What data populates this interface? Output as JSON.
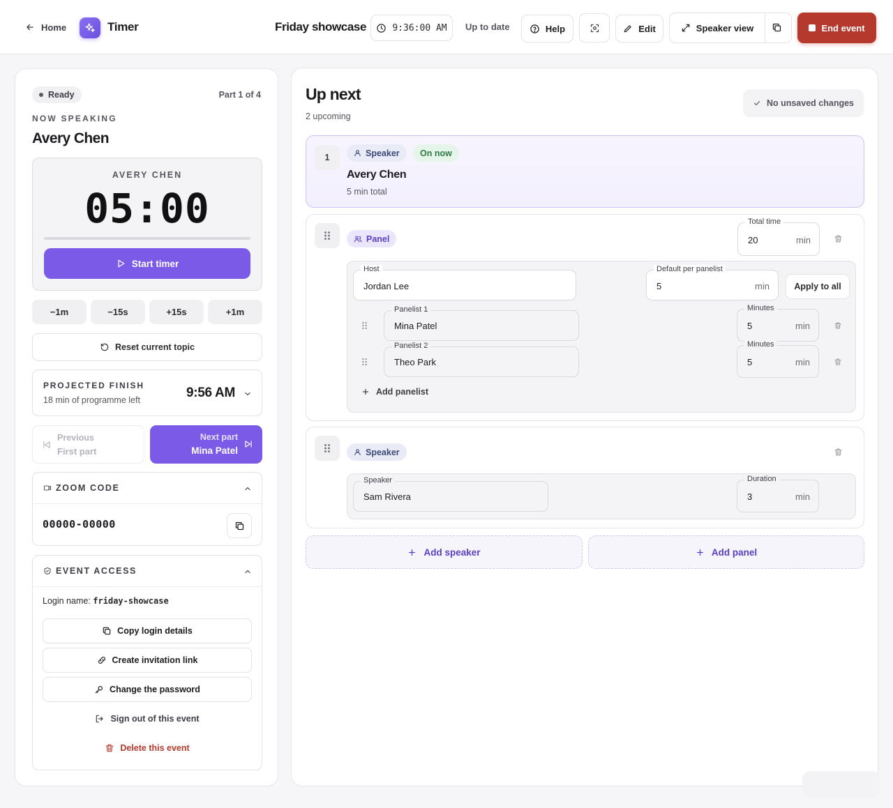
{
  "topbar": {
    "home_label": "Home",
    "app_name": "Timer",
    "event_name": "Friday showcase",
    "clock_time": "9:36:00 AM",
    "sync_status": "Up to date",
    "help_label": "Help",
    "edit_label": "Edit",
    "speaker_view_label": "Speaker view",
    "end_event_label": "End event",
    "end_color": "#b5392c"
  },
  "left": {
    "status": "Ready",
    "part": "Part 1 of 4",
    "now_speaking_label": "NOW SPEAKING",
    "now_speaking_name": "Avery Chen",
    "timer": {
      "speaker": "AVERY CHEN",
      "display": "05:00",
      "progress_pct": 0,
      "start_label": "Start timer"
    },
    "adjust_buttons": [
      "−1m",
      "−15s",
      "+15s",
      "+1m"
    ],
    "reset_label": "Reset current topic",
    "projected": {
      "label": "PROJECTED FINISH",
      "sub": "18 min of programme left",
      "time": "9:56 AM"
    },
    "previous": {
      "label": "Previous",
      "name": "First part"
    },
    "next": {
      "label": "Next part",
      "name": "Mina Patel"
    },
    "zoom": {
      "title": "ZOOM CODE",
      "code": "00000-00000"
    },
    "access": {
      "title": "EVENT ACCESS",
      "login_label": "Login name:",
      "login_value": "friday-showcase",
      "copy_label": "Copy login details",
      "invite_label": "Create invitation link",
      "password_label": "Change the password",
      "signout_label": "Sign out of this event",
      "delete_label": "Delete this event"
    },
    "accent": "#7a5ae6"
  },
  "right": {
    "title": "Up next",
    "count": "2 upcoming",
    "unsaved": "No unsaved changes",
    "current": {
      "number": "1",
      "tag": "Speaker",
      "badge": "On now",
      "name": "Avery Chen",
      "total": "5 min total"
    },
    "panel": {
      "tag": "Panel",
      "total_label": "Total time",
      "total_value": "20",
      "unit": "min",
      "host_label": "Host",
      "host_value": "Jordan Lee",
      "default_label": "Default per panelist",
      "default_value": "5",
      "apply_label": "Apply to all",
      "panelists": [
        {
          "label": "Panelist 1",
          "name": "Mina Patel",
          "minutes_label": "Minutes",
          "minutes": "5"
        },
        {
          "label": "Panelist 2",
          "name": "Theo Park",
          "minutes_label": "Minutes",
          "minutes": "5"
        }
      ],
      "add_panelist_label": "Add panelist"
    },
    "speaker": {
      "tag": "Speaker",
      "speaker_label": "Speaker",
      "speaker_value": "Sam Rivera",
      "duration_label": "Duration",
      "duration_value": "3",
      "unit": "min"
    },
    "add_speaker_label": "Add speaker",
    "add_panel_label": "Add panel"
  }
}
